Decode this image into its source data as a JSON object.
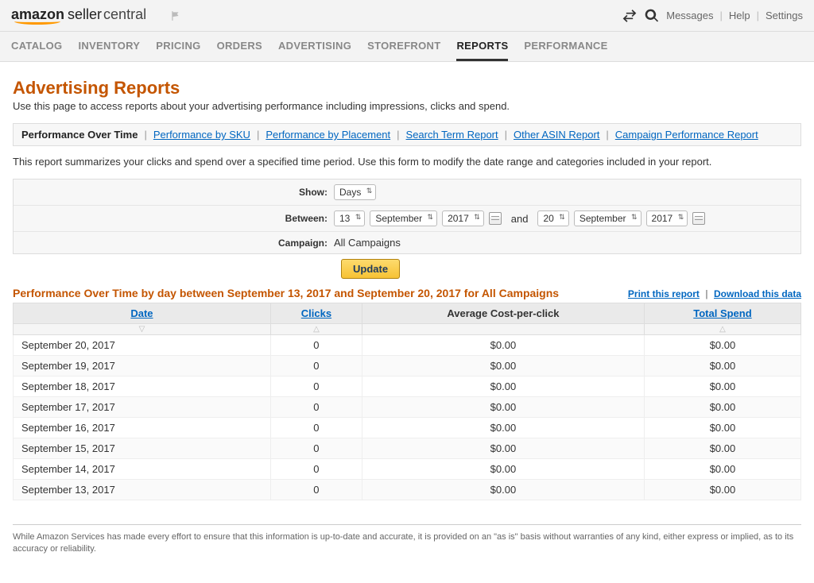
{
  "header": {
    "logo_amazon": "amazon",
    "logo_seller": "seller",
    "logo_central": "central",
    "links": {
      "messages": "Messages",
      "help": "Help",
      "settings": "Settings"
    }
  },
  "nav": [
    {
      "label": "CATALOG"
    },
    {
      "label": "INVENTORY"
    },
    {
      "label": "PRICING"
    },
    {
      "label": "ORDERS"
    },
    {
      "label": "ADVERTISING"
    },
    {
      "label": "STOREFRONT"
    },
    {
      "label": "REPORTS",
      "active": true
    },
    {
      "label": "PERFORMANCE"
    }
  ],
  "page": {
    "title": "Advertising Reports",
    "description": "Use this page to access reports about your advertising performance including impressions, clicks and spend."
  },
  "tabs": [
    {
      "label": "Performance Over Time",
      "active": true
    },
    {
      "label": "Performance by SKU"
    },
    {
      "label": "Performance by Placement"
    },
    {
      "label": "Search Term Report"
    },
    {
      "label": "Other ASIN Report"
    },
    {
      "label": "Campaign Performance Report"
    }
  ],
  "summary_text": "This report summarizes your clicks and spend over a specified time period. Use this form to modify the date range and categories included in your report.",
  "form": {
    "show_label": "Show:",
    "show_value": "Days",
    "between_label": "Between:",
    "from_day": "13",
    "from_month": "September",
    "from_year": "2017",
    "and": "and",
    "to_day": "20",
    "to_month": "September",
    "to_year": "2017",
    "campaign_label": "Campaign:",
    "campaign_value": "All Campaigns",
    "update_button": "Update"
  },
  "table": {
    "title": "Performance Over Time by day between September 13, 2017 and September 20, 2017 for All Campaigns",
    "print_link": "Print this report",
    "download_link": "Download this data",
    "columns": {
      "date": "Date",
      "clicks": "Clicks",
      "cpc": "Average Cost-per-click",
      "spend": "Total Spend"
    },
    "rows": [
      {
        "date": "September 20, 2017",
        "clicks": "0",
        "cpc": "$0.00",
        "spend": "$0.00"
      },
      {
        "date": "September 19, 2017",
        "clicks": "0",
        "cpc": "$0.00",
        "spend": "$0.00"
      },
      {
        "date": "September 18, 2017",
        "clicks": "0",
        "cpc": "$0.00",
        "spend": "$0.00"
      },
      {
        "date": "September 17, 2017",
        "clicks": "0",
        "cpc": "$0.00",
        "spend": "$0.00"
      },
      {
        "date": "September 16, 2017",
        "clicks": "0",
        "cpc": "$0.00",
        "spend": "$0.00"
      },
      {
        "date": "September 15, 2017",
        "clicks": "0",
        "cpc": "$0.00",
        "spend": "$0.00"
      },
      {
        "date": "September 14, 2017",
        "clicks": "0",
        "cpc": "$0.00",
        "spend": "$0.00"
      },
      {
        "date": "September 13, 2017",
        "clicks": "0",
        "cpc": "$0.00",
        "spend": "$0.00"
      }
    ]
  },
  "disclaimer": "While Amazon Services has made every effort to ensure that this information is up-to-date and accurate, it is provided on an \"as is\" basis without warranties of any kind, either express or implied, as to its accuracy or reliability."
}
